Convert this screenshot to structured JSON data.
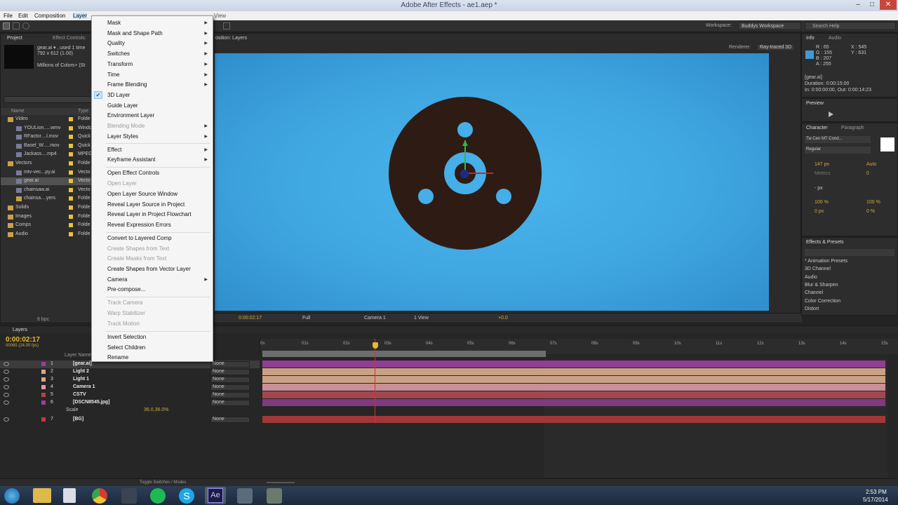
{
  "window": {
    "title": "Adobe After Effects - ae1.aep *"
  },
  "menubar": [
    "File",
    "Edit",
    "Composition",
    "Layer",
    "Effect",
    "Animation",
    "View",
    "Window",
    "Help"
  ],
  "toolbar": {
    "workspace_label": "Workspace:",
    "workspace_value": "Buddys Workspace",
    "search_placeholder": "Search Help"
  },
  "project": {
    "tabs": [
      "Project",
      "Effect Controls:"
    ],
    "asset_name": "gear.ai ▾ , used 1 time",
    "asset_dims": "792 x 612 (1.00)",
    "asset_colors": "Millions of Colors+ (St",
    "col_name": "Name",
    "col_type": "Type",
    "items": [
      {
        "name": "Video",
        "type": "Folde",
        "indent": 0,
        "kind": "folder"
      },
      {
        "name": "YOULion.....wmv",
        "type": "Windo",
        "indent": 1,
        "kind": "file"
      },
      {
        "name": "RFactor....l.mov",
        "type": "Quick",
        "indent": 1,
        "kind": "file"
      },
      {
        "name": "Basel_W.....mov",
        "type": "Quick",
        "indent": 1,
        "kind": "file"
      },
      {
        "name": "Jackass....mp4",
        "type": "MPEG",
        "indent": 1,
        "kind": "file"
      },
      {
        "name": "Vectors",
        "type": "Folde",
        "indent": 0,
        "kind": "folder"
      },
      {
        "name": "mtv-vec...py.ai",
        "type": "Vecto",
        "indent": 1,
        "kind": "file"
      },
      {
        "name": "gear.ai",
        "type": "Vecto",
        "indent": 1,
        "kind": "file"
      },
      {
        "name": "chainsaw.ai",
        "type": "Vecto",
        "indent": 1,
        "kind": "file"
      },
      {
        "name": "chainsa....yers",
        "type": "Folde",
        "indent": 1,
        "kind": "folder"
      },
      {
        "name": "Solids",
        "type": "Folde",
        "indent": 0,
        "kind": "folder"
      },
      {
        "name": "Images",
        "type": "Folde",
        "indent": 0,
        "kind": "folder"
      },
      {
        "name": "Comps",
        "type": "Folde",
        "indent": 0,
        "kind": "folder"
      },
      {
        "name": "Audio",
        "type": "Folde",
        "indent": 0,
        "kind": "folder"
      }
    ],
    "bpc": "8 bpc"
  },
  "context_menu": [
    {
      "label": "Mask",
      "sub": true,
      "disabled": false
    },
    {
      "label": "Mask and Shape Path",
      "sub": true,
      "disabled": false
    },
    {
      "label": "Quality",
      "sub": true,
      "disabled": false
    },
    {
      "label": "Switches",
      "sub": true,
      "disabled": false
    },
    {
      "label": "Transform",
      "sub": true,
      "disabled": false
    },
    {
      "label": "Time",
      "sub": true,
      "disabled": false
    },
    {
      "label": "Frame Blending",
      "sub": true,
      "disabled": false
    },
    {
      "label": "3D Layer",
      "checked": true,
      "disabled": false
    },
    {
      "label": "Guide Layer",
      "disabled": false
    },
    {
      "label": "Environment Layer",
      "disabled": false
    },
    {
      "label": "Blending Mode",
      "sub": true,
      "disabled": true
    },
    {
      "label": "Layer Styles",
      "sub": true,
      "disabled": false
    },
    {
      "sep": true
    },
    {
      "label": "Effect",
      "sub": true,
      "disabled": false
    },
    {
      "label": "Keyframe Assistant",
      "sub": true,
      "disabled": false
    },
    {
      "sep": true
    },
    {
      "label": "Open Effect Controls",
      "disabled": false
    },
    {
      "label": "Open Layer",
      "disabled": true
    },
    {
      "label": "Open Layer Source Window",
      "disabled": false
    },
    {
      "label": "Reveal Layer Source in Project",
      "disabled": false
    },
    {
      "label": "Reveal Layer in Project Flowchart",
      "disabled": false
    },
    {
      "label": "Reveal Expression Errors",
      "disabled": false
    },
    {
      "sep": true
    },
    {
      "label": "Convert to Layered Comp",
      "disabled": false
    },
    {
      "label": "Create Shapes from Text",
      "disabled": true
    },
    {
      "label": "Create Masks from Text",
      "disabled": true
    },
    {
      "label": "Create Shapes from Vector Layer",
      "disabled": false
    },
    {
      "label": "Camera",
      "sub": true,
      "disabled": false
    },
    {
      "label": "Pre-compose...",
      "disabled": false
    },
    {
      "sep": true
    },
    {
      "label": "Track Camera",
      "disabled": true
    },
    {
      "label": "Warp Stabilizer",
      "disabled": true
    },
    {
      "label": "Track Motion",
      "disabled": true
    },
    {
      "sep": true
    },
    {
      "label": "Invert Selection",
      "disabled": false
    },
    {
      "label": "Select Children",
      "disabled": false
    },
    {
      "label": "Rename",
      "disabled": false
    }
  ],
  "composition": {
    "tab": "osition: Layers",
    "renderer_label": "Renderer:",
    "renderer_value": "Ray-traced 3D",
    "timecode": "0:00:02:17",
    "resolution": "Full",
    "camera": "Camera 1",
    "view": "1 View",
    "exposure": "+0.0"
  },
  "info": {
    "tabs": [
      "Info",
      "Audio"
    ],
    "r": "R : 65",
    "g": "G : 155",
    "b": "B : 207",
    "a": "A : 255",
    "x": "X : 545",
    "y": "Y : 631",
    "file": "[gear.ai]",
    "duration": "Duration: 0:00:15:00",
    "inout": "In: 0:00:00:00, Out: 0:00:14:23",
    "swatch": "#419bcf"
  },
  "preview": {
    "tab": "Preview"
  },
  "character": {
    "tabs": [
      "Character",
      "Paragraph"
    ],
    "font": "Tw Cen MT Cond...",
    "style": "Regular",
    "size": "147 px",
    "leading": "Auto",
    "kerning": "Metrics",
    "tracking": "0",
    "unit": "- px",
    "vscale": "100 %",
    "hscale": "100 %",
    "baseline": "0 px",
    "tsume": "0 %"
  },
  "effects": {
    "tab": "Effects & Presets",
    "items": [
      "* Animation Presets",
      "3D Channel",
      "Audio",
      "Blur & Sharpen",
      "Channel",
      "Color Correction",
      "Distort"
    ]
  },
  "timeline": {
    "tab": "Layers",
    "timecode": "0:00:02:17",
    "fps": "00065 (24.00 fps)",
    "col_layer": "Layer Name",
    "ruler": [
      "0s",
      "01s",
      "02s",
      "03s",
      "04s",
      "05s",
      "06s",
      "07s",
      "08s",
      "09s",
      "10s",
      "11s",
      "12s",
      "13s",
      "14s",
      "15s"
    ],
    "layers": [
      {
        "num": "1",
        "name": "[gear.ai]",
        "parent": "None",
        "color": "#9a3f98",
        "bar": "#8f3f94"
      },
      {
        "num": "2",
        "name": "Light 2",
        "parent": "None",
        "color": "#d9a88a",
        "bar": "#c9a184"
      },
      {
        "num": "3",
        "name": "Light 1",
        "parent": "None",
        "color": "#d9a88a",
        "bar": "#c9a184"
      },
      {
        "num": "4",
        "name": "Camera 1",
        "parent": "None",
        "color": "#e49aa8",
        "bar": "#c99197"
      },
      {
        "num": "5",
        "name": "CSTV",
        "parent": "None",
        "color": "#b8404a",
        "bar": "#a34650"
      },
      {
        "num": "6",
        "name": "[DSCN8545.jpg]",
        "parent": "None",
        "color": "#9a3f98",
        "bar": "#7f3a82"
      },
      {
        "num": "7",
        "name": "[BG]",
        "parent": "None",
        "color": "#c23a3a",
        "bar": "#a33638"
      }
    ],
    "scale_label": "Scale",
    "scale_value": "36.0,36.0%",
    "toggle": "Toggle Switches / Modes"
  },
  "taskbar": {
    "time": "2:53 PM",
    "date": "5/17/2014"
  }
}
